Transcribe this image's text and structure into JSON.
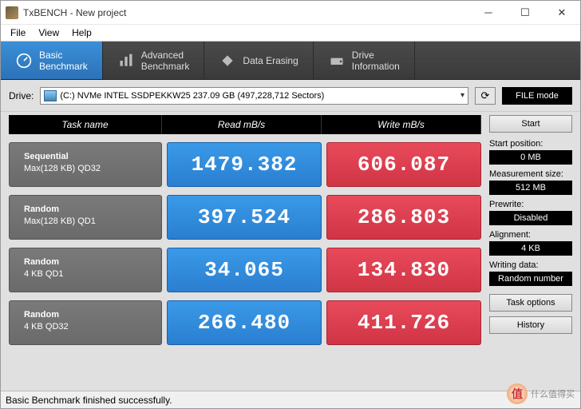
{
  "window": {
    "title": "TxBENCH - New project"
  },
  "menu": {
    "file": "File",
    "view": "View",
    "help": "Help"
  },
  "tabs": {
    "basic": {
      "line1": "Basic",
      "line2": "Benchmark"
    },
    "advanced": {
      "line1": "Advanced",
      "line2": "Benchmark"
    },
    "erase": {
      "line1": "Data Erasing"
    },
    "info": {
      "line1": "Drive",
      "line2": "Information"
    }
  },
  "drive": {
    "label": "Drive:",
    "selected": "(C:) NVMe INTEL SSDPEKKW25  237.09 GB (497,228,712 Sectors)"
  },
  "filemode": "FILE mode",
  "headers": {
    "task": "Task name",
    "read": "Read mB/s",
    "write": "Write mB/s"
  },
  "rows": [
    {
      "name1": "Sequential",
      "name2": "Max(128 KB) QD32",
      "read": "1479.382",
      "write": "606.087"
    },
    {
      "name1": "Random",
      "name2": "Max(128 KB) QD1",
      "read": "397.524",
      "write": "286.803"
    },
    {
      "name1": "Random",
      "name2": "4 KB QD1",
      "read": "34.065",
      "write": "134.830"
    },
    {
      "name1": "Random",
      "name2": "4 KB QD32",
      "read": "266.480",
      "write": "411.726"
    }
  ],
  "side": {
    "start": "Start",
    "startpos_lbl": "Start position:",
    "startpos_val": "0 MB",
    "meas_lbl": "Measurement size:",
    "meas_val": "512 MB",
    "prewrite_lbl": "Prewrite:",
    "prewrite_val": "Disabled",
    "align_lbl": "Alignment:",
    "align_val": "4 KB",
    "wdata_lbl": "Writing data:",
    "wdata_val": "Random number",
    "taskopt": "Task options",
    "history": "History"
  },
  "status": "Basic Benchmark finished successfully.",
  "watermark": "什么值得买"
}
